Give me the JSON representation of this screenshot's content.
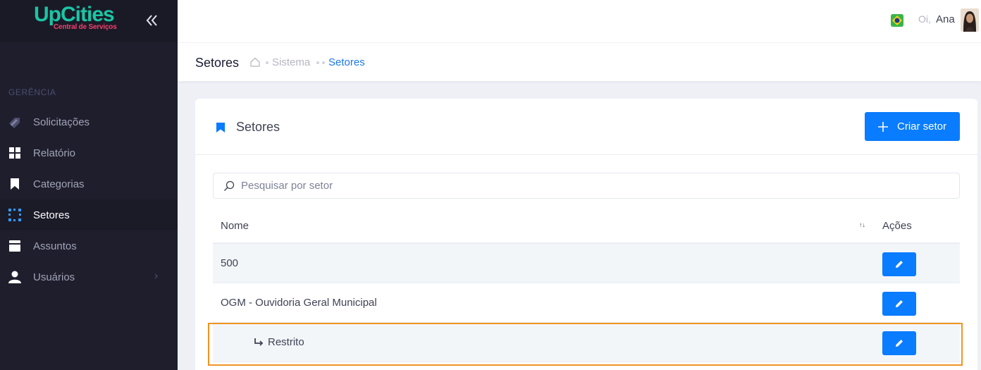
{
  "brand": {
    "logo_main": "UpCities",
    "logo_sub": "Central de Serviços"
  },
  "sidebar": {
    "section_label": "GERÊNCIA",
    "items": [
      {
        "label": "Solicitações",
        "icon": "tag-icon"
      },
      {
        "label": "Relatório",
        "icon": "grid-icon"
      },
      {
        "label": "Categorias",
        "icon": "bookmark-icon"
      },
      {
        "label": "Setores",
        "icon": "dots-grid-icon",
        "active": true
      },
      {
        "label": "Assuntos",
        "icon": "book-icon"
      },
      {
        "label": "Usuários",
        "icon": "user-icon",
        "has_submenu": true
      }
    ]
  },
  "header": {
    "greeting": "Oi,",
    "username": "Ana"
  },
  "subheader": {
    "title": "Setores",
    "breadcrumb": [
      "Sistema",
      "Setores"
    ]
  },
  "card": {
    "title": "Setores",
    "create_button": "Criar setor",
    "search_placeholder": "Pesquisar por setor",
    "columns": {
      "name": "Nome",
      "sort_indicator": "↑↓",
      "actions": "Ações"
    },
    "rows": [
      {
        "name": "500",
        "child": false
      },
      {
        "name": "OGM - Ouvidoria Geral Municipal",
        "child": false
      },
      {
        "name": "Restrito",
        "child": true
      }
    ]
  },
  "colors": {
    "sidebar_bg": "#1e1e2d",
    "primary": "#0a7cff",
    "brand_green": "#1bc5a4",
    "brand_red": "#f1416c",
    "highlight": "#f09423"
  }
}
